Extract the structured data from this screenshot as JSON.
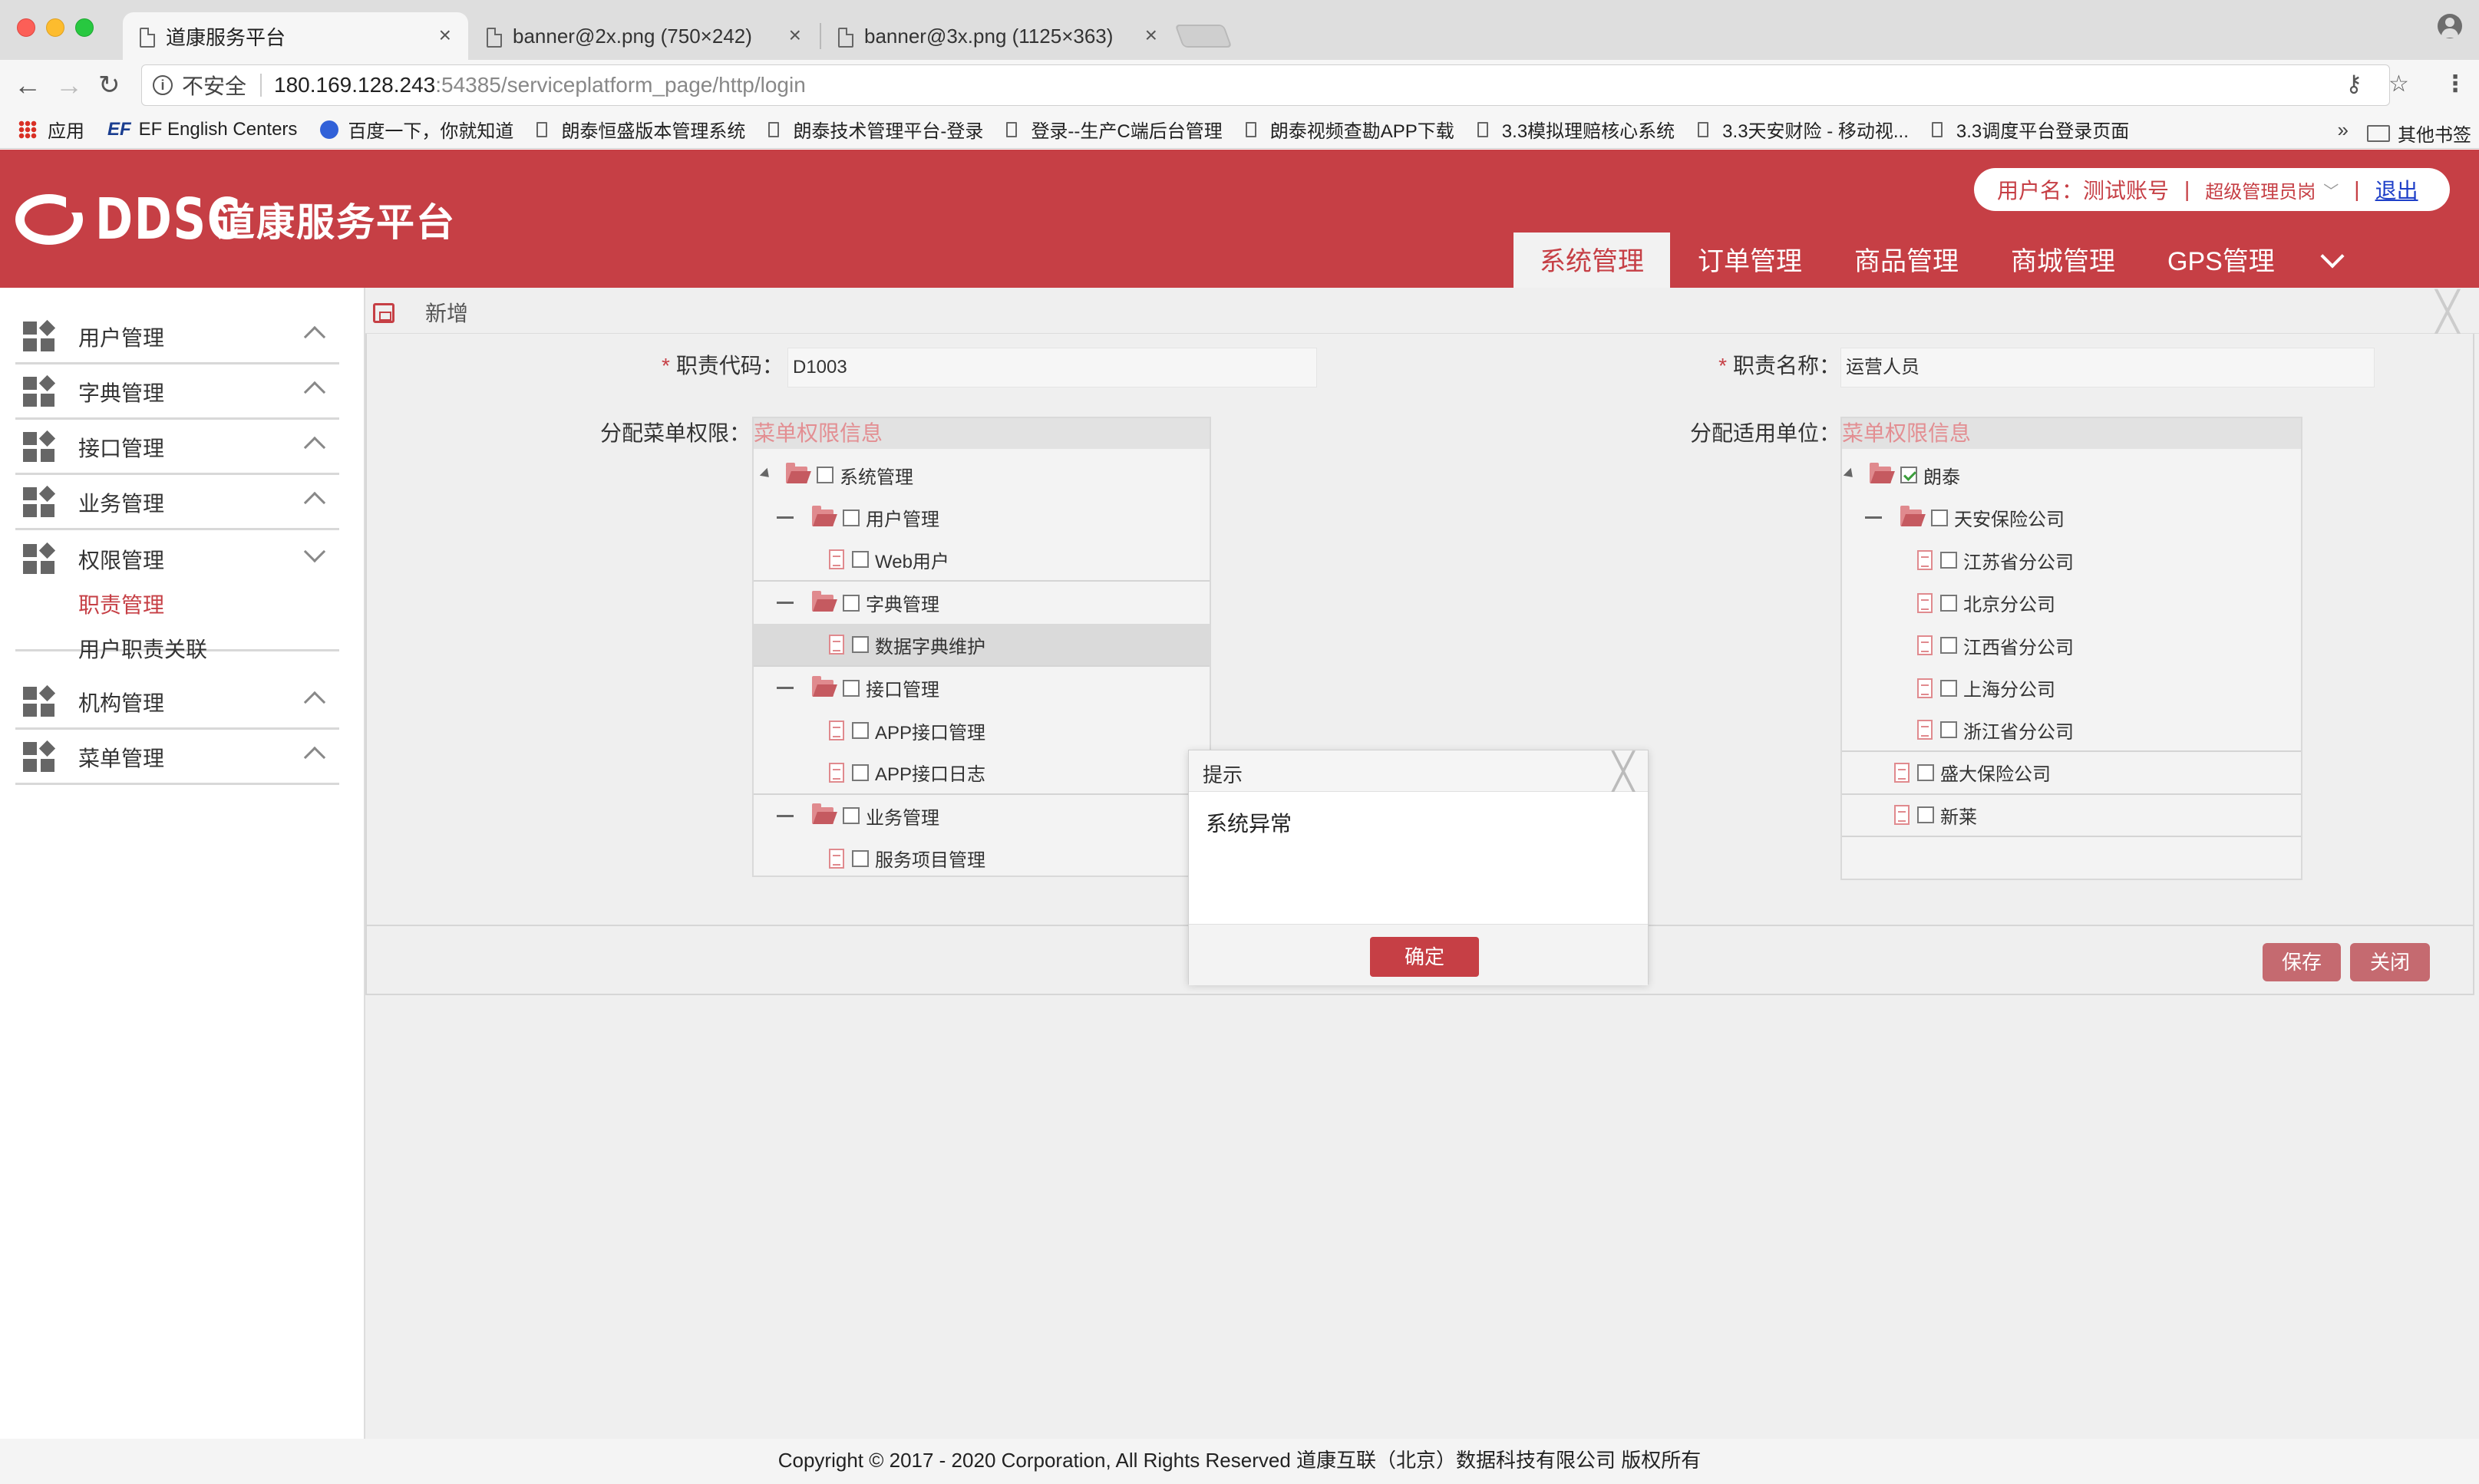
{
  "browser": {
    "tabs": [
      {
        "title": "道康服务平台",
        "active": true
      },
      {
        "title": "banner@2x.png (750×242)",
        "active": false
      },
      {
        "title": "banner@3x.png (1125×363)",
        "active": false
      }
    ],
    "tab_close": "×",
    "insecure_label": "不安全",
    "url_host": "180.169.128.243",
    "url_rest": ":54385/serviceplatform_page/http/login",
    "bookmarks": [
      {
        "label": "应用",
        "icon": "apps-grid-icon"
      },
      {
        "label": "EF English Centers",
        "icon": "ef-logo-icon"
      },
      {
        "label": "百度一下，你就知道",
        "icon": "baidu-paw-icon"
      },
      {
        "label": "朗泰恒盛版本管理系统",
        "icon": "page-icon"
      },
      {
        "label": "朗泰技术管理平台-登录",
        "icon": "page-icon"
      },
      {
        "label": "登录--生产C端后台管理",
        "icon": "page-icon"
      },
      {
        "label": "朗泰视频查勘APP下载",
        "icon": "page-icon"
      },
      {
        "label": "3.3模拟理赔核心系统",
        "icon": "page-icon"
      },
      {
        "label": "3.3天安财险 - 移动视...",
        "icon": "page-icon"
      },
      {
        "label": "3.3调度平台登录页面",
        "icon": "page-icon"
      }
    ],
    "bookmarks_more": "»",
    "other_bookmarks": "其他书签"
  },
  "header": {
    "logo_mark": "DDSC",
    "logo_text": "道康服务平台",
    "user_label": "用户名：测试账号",
    "role": "超级管理员岗",
    "logout": "退出",
    "pill_sep": "|",
    "nav": [
      {
        "label": "系统管理",
        "active": true
      },
      {
        "label": "订单管理",
        "active": false
      },
      {
        "label": "商品管理",
        "active": false
      },
      {
        "label": "商城管理",
        "active": false
      },
      {
        "label": "GPS管理",
        "active": false
      }
    ]
  },
  "sidebar": {
    "items": [
      {
        "label": "用户管理",
        "expanded": false
      },
      {
        "label": "字典管理",
        "expanded": false
      },
      {
        "label": "接口管理",
        "expanded": false
      },
      {
        "label": "业务管理",
        "expanded": false
      },
      {
        "label": "权限管理",
        "expanded": true
      },
      {
        "label": "机构管理",
        "expanded": false
      },
      {
        "label": "菜单管理",
        "expanded": false
      }
    ],
    "sub_items": [
      {
        "label": "职责管理",
        "active": true
      },
      {
        "label": "用户职责关联",
        "active": false
      }
    ]
  },
  "panel": {
    "title": "新增",
    "close": "╳"
  },
  "form": {
    "required_mark": "*",
    "code_label": "职责代码：",
    "code_value": "D1003",
    "name_label": "职责名称：",
    "name_value": "运营人员",
    "menu_label": "分配菜单权限：",
    "unit_label": "分配适用单位：",
    "tree_header": "菜单权限信息"
  },
  "menu_tree": [
    {
      "label": "系统管理",
      "type": "folder",
      "toggle": "tri",
      "level": 0
    },
    {
      "label": "用户管理",
      "type": "folder",
      "toggle": "dash",
      "level": 1
    },
    {
      "label": "Web用户",
      "type": "file",
      "toggle": "",
      "level": 2,
      "group_end": true
    },
    {
      "label": "字典管理",
      "type": "folder",
      "toggle": "dash",
      "level": 1
    },
    {
      "label": "数据字典维护",
      "type": "file",
      "toggle": "",
      "level": 2,
      "selected": true,
      "group_end": true
    },
    {
      "label": "接口管理",
      "type": "folder",
      "toggle": "dash",
      "level": 1
    },
    {
      "label": "APP接口管理",
      "type": "file",
      "toggle": "",
      "level": 2
    },
    {
      "label": "APP接口日志",
      "type": "file",
      "toggle": "",
      "level": 2,
      "group_end": true
    },
    {
      "label": "业务管理",
      "type": "folder",
      "toggle": "dash",
      "level": 1
    },
    {
      "label": "服务项目管理",
      "type": "file",
      "toggle": "",
      "level": 2
    }
  ],
  "unit_tree": [
    {
      "label": "朗泰",
      "type": "folder",
      "toggle": "tri",
      "level": 0,
      "checked": true
    },
    {
      "label": "天安保险公司",
      "type": "folder",
      "toggle": "dash",
      "level": 1
    },
    {
      "label": "江苏省分公司",
      "type": "file",
      "toggle": "",
      "level": 2
    },
    {
      "label": "北京分公司",
      "type": "file",
      "toggle": "",
      "level": 2
    },
    {
      "label": "江西省分公司",
      "type": "file",
      "toggle": "",
      "level": 2
    },
    {
      "label": "上海分公司",
      "type": "file",
      "toggle": "",
      "level": 2
    },
    {
      "label": "浙江省分公司",
      "type": "file",
      "toggle": "",
      "level": 2,
      "group_end": true
    },
    {
      "label": "盛大保险公司",
      "type": "file",
      "toggle": "",
      "level": 1,
      "group_end": true
    },
    {
      "label": "新莱",
      "type": "file",
      "toggle": "",
      "level": 1,
      "group_end": true
    }
  ],
  "buttons": {
    "save": "保存",
    "close": "关闭"
  },
  "dialog": {
    "title": "提示",
    "message": "系统异常",
    "ok": "确定",
    "close": "╳"
  },
  "footer": {
    "copyright": "Copyright © 2017 - 2020 Corporation, All Rights Reserved 道康互联（北京）数据科技有限公司 版权所有"
  },
  "colors": {
    "brand_red": "#c63f45",
    "muted_red_button": "#c56a70",
    "tree_header_text": "#e38e92"
  }
}
